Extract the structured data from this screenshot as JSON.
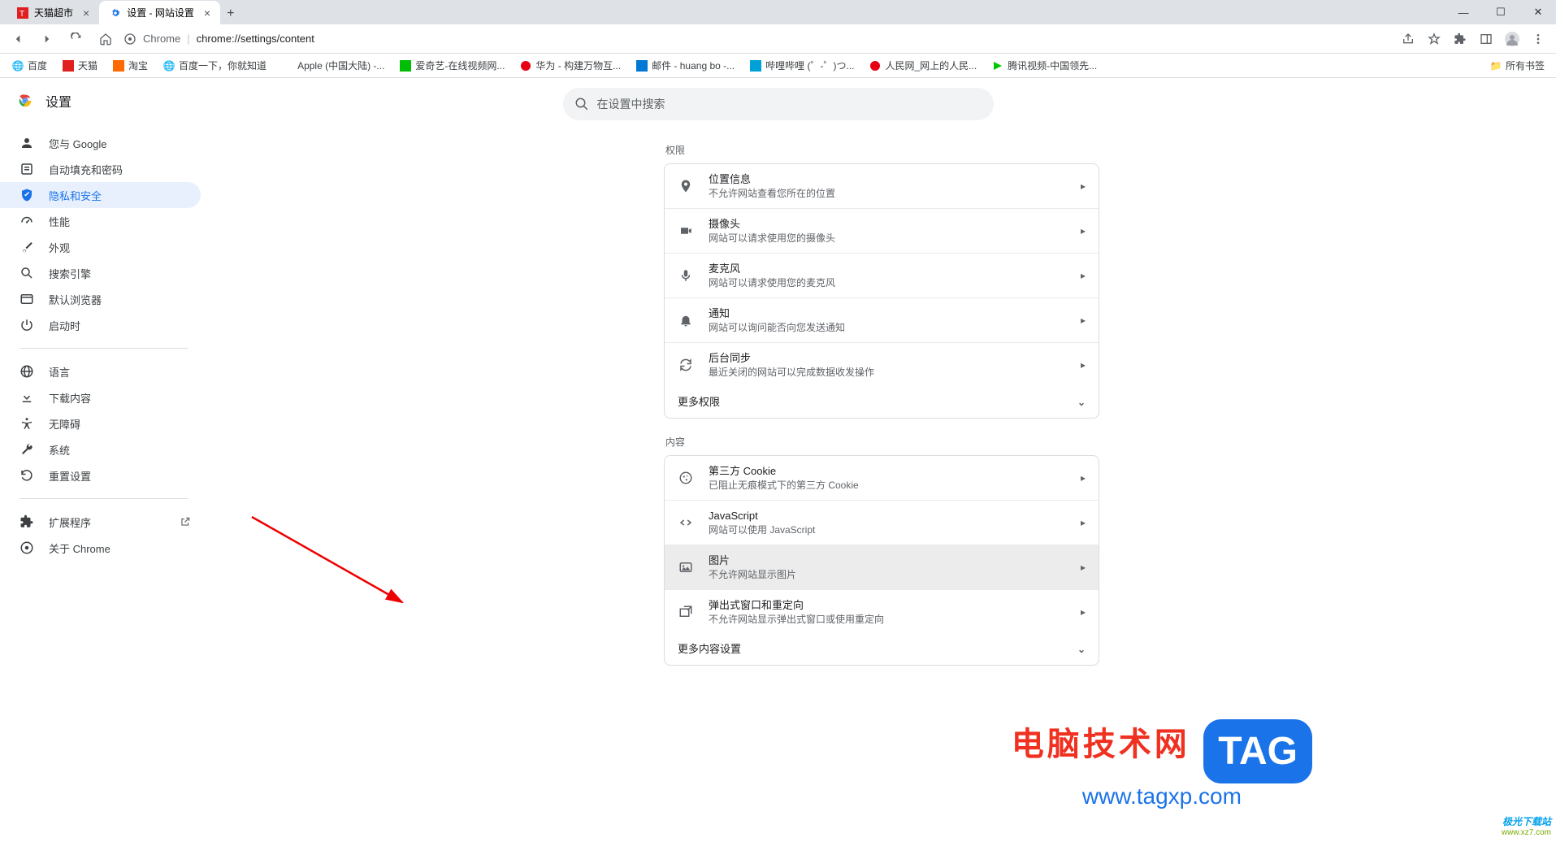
{
  "window": {
    "tabs": [
      {
        "title": "天猫超市",
        "active": false
      },
      {
        "title": "设置 - 网站设置",
        "active": true
      }
    ],
    "minimize": "—",
    "maximize": "☐",
    "close": "✕"
  },
  "toolbar": {
    "url_scheme": "Chrome",
    "url_path": "chrome://settings/content"
  },
  "bookmarks": {
    "items": [
      "百度",
      "天猫",
      "淘宝",
      "百度一下，你就知道",
      "Apple (中国大陆) -...",
      "爱奇艺-在线视频网...",
      "华为 - 构建万物互...",
      "邮件 - huang bo -...",
      "哔哩哔哩 (゜-゜)つ...",
      "人民网_网上的人民...",
      "腾讯视频-中国领先..."
    ],
    "all_bookmarks": "所有书签"
  },
  "app": {
    "title": "设置",
    "search_placeholder": "在设置中搜索"
  },
  "sidebar": {
    "items": [
      {
        "id": "you-google",
        "label": "您与 Google",
        "icon": "person"
      },
      {
        "id": "autofill",
        "label": "自动填充和密码",
        "icon": "autofill"
      },
      {
        "id": "privacy",
        "label": "隐私和安全",
        "icon": "shield",
        "active": true
      },
      {
        "id": "performance",
        "label": "性能",
        "icon": "speed"
      },
      {
        "id": "appearance",
        "label": "外观",
        "icon": "brush"
      },
      {
        "id": "search-engine",
        "label": "搜索引擎",
        "icon": "search"
      },
      {
        "id": "default-browser",
        "label": "默认浏览器",
        "icon": "browser"
      },
      {
        "id": "on-startup",
        "label": "启动时",
        "icon": "power"
      }
    ],
    "items2": [
      {
        "id": "language",
        "label": "语言",
        "icon": "globe"
      },
      {
        "id": "downloads",
        "label": "下载内容",
        "icon": "download"
      },
      {
        "id": "accessibility",
        "label": "无障碍",
        "icon": "a11y"
      },
      {
        "id": "system",
        "label": "系统",
        "icon": "wrench"
      },
      {
        "id": "reset",
        "label": "重置设置",
        "icon": "restore"
      }
    ],
    "items3": [
      {
        "id": "extensions",
        "label": "扩展程序",
        "icon": "puzzle",
        "external": true
      },
      {
        "id": "about",
        "label": "关于 Chrome",
        "icon": "chrome"
      }
    ]
  },
  "sections": {
    "permissions_label": "权限",
    "content_label": "内容",
    "permissions": [
      {
        "id": "location",
        "title": "位置信息",
        "desc": "不允许网站查看您所在的位置",
        "icon": "pin"
      },
      {
        "id": "camera",
        "title": "摄像头",
        "desc": "网站可以请求使用您的摄像头",
        "icon": "camera"
      },
      {
        "id": "mic",
        "title": "麦克风",
        "desc": "网站可以请求使用您的麦克风",
        "icon": "mic"
      },
      {
        "id": "notifications",
        "title": "通知",
        "desc": "网站可以询问能否向您发送通知",
        "icon": "bell"
      },
      {
        "id": "bg-sync",
        "title": "后台同步",
        "desc": "最近关闭的网站可以完成数据收发操作",
        "icon": "sync"
      }
    ],
    "more_permissions": "更多权限",
    "content": [
      {
        "id": "cookies",
        "title": "第三方 Cookie",
        "desc": "已阻止无痕模式下的第三方 Cookie",
        "icon": "cookie"
      },
      {
        "id": "javascript",
        "title": "JavaScript",
        "desc": "网站可以使用 JavaScript",
        "icon": "code"
      },
      {
        "id": "images",
        "title": "图片",
        "desc": "不允许网站显示图片",
        "icon": "image",
        "highlight": true
      },
      {
        "id": "popups",
        "title": "弹出式窗口和重定向",
        "desc": "不允许网站显示弹出式窗口或使用重定向",
        "icon": "popup"
      }
    ],
    "more_content": "更多内容设置"
  },
  "watermark": {
    "title": "电脑技术网",
    "url": "www.tagxp.com",
    "badge": "TAG",
    "corner_a": "极光下载站",
    "corner_b": "www.xz7.com"
  }
}
